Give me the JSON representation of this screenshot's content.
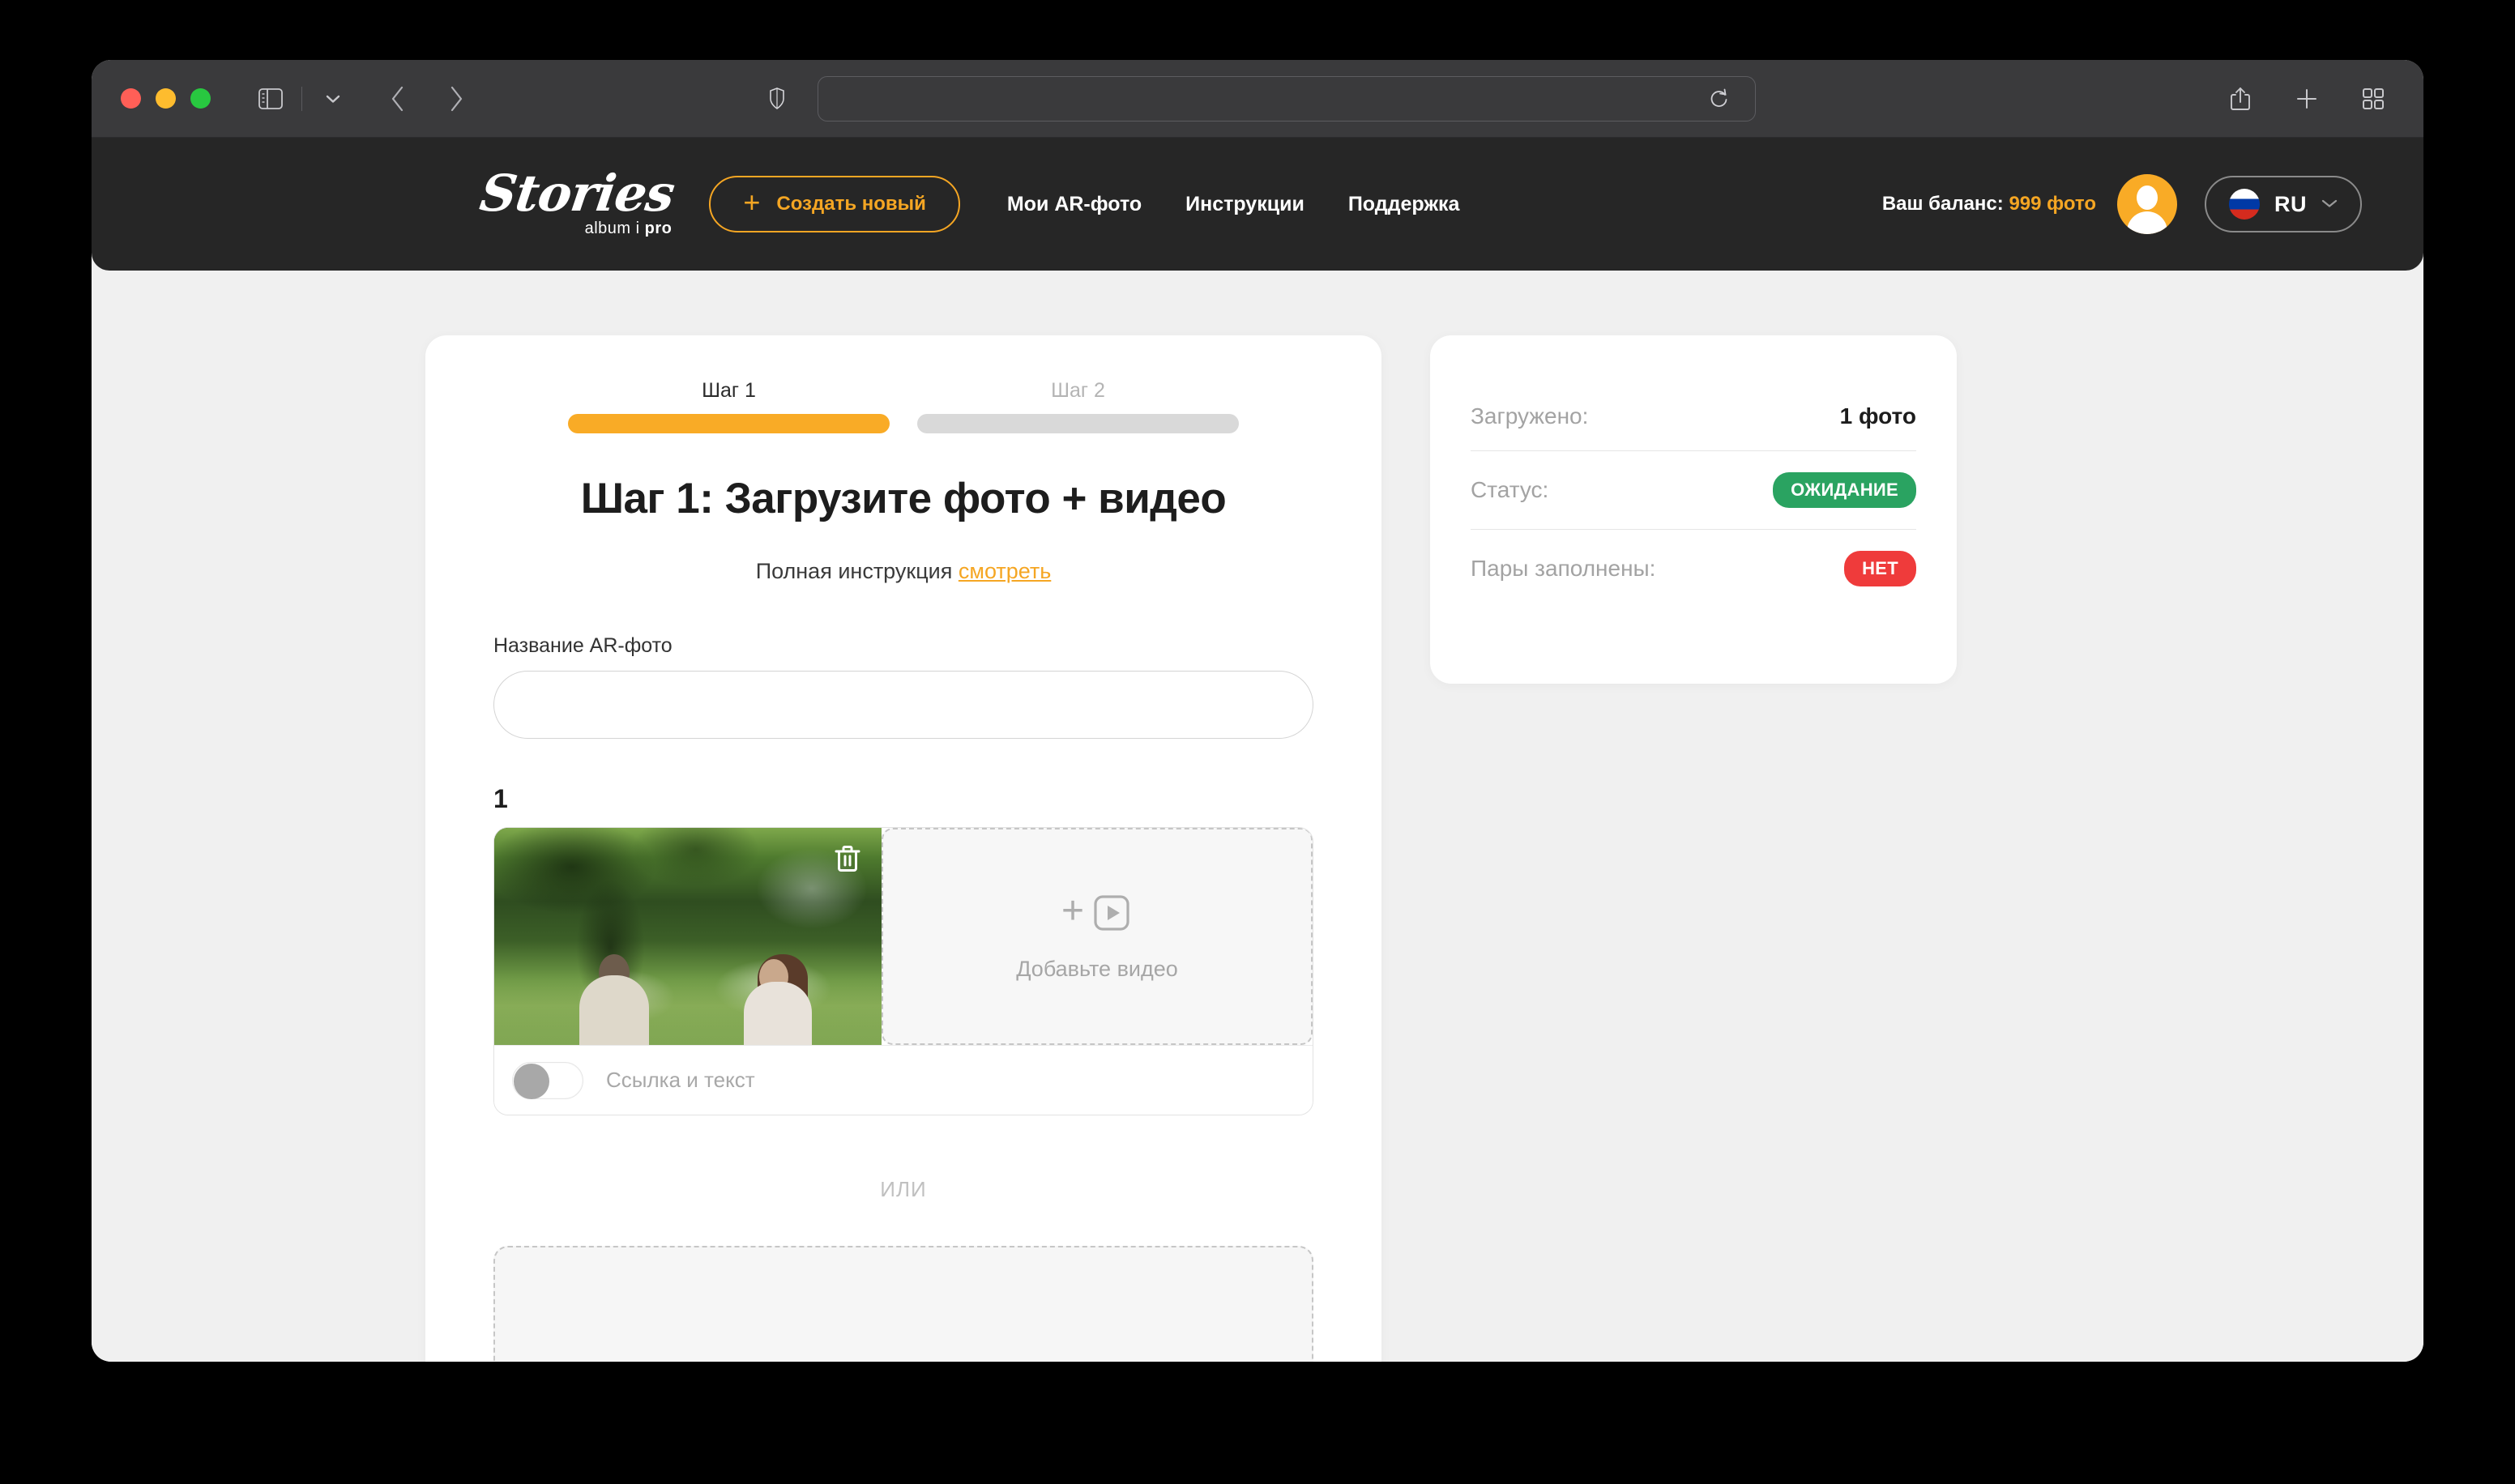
{
  "browser": {
    "traffic_lights": [
      "close",
      "minimize",
      "maximize"
    ],
    "sidebar_icon": "sidebar-icon",
    "dropdown_icon": "chevron-down-icon",
    "back_icon": "chevron-left-icon",
    "forward_icon": "chevron-right-icon",
    "shield_icon": "shield-icon",
    "address_value": "",
    "address_placeholder": "",
    "reload_icon": "reload-icon",
    "share_icon": "share-icon",
    "new_tab_icon": "plus-icon",
    "tab_overview_icon": "tab-grid-icon"
  },
  "header": {
    "brand_script": "Stories",
    "brand_sub_1": "album i ",
    "brand_sub_2": "pro",
    "create_button": "Создать новый",
    "create_button_icon": "plus-icon",
    "nav": [
      {
        "label": "Мои AR-фото"
      },
      {
        "label": "Инструкции"
      },
      {
        "label": "Поддержка"
      }
    ],
    "balance_label": "Ваш баланс:",
    "balance_value": "999 фото",
    "avatar_icon": "user-avatar-icon",
    "lang_code": "RU",
    "lang_flag": "flag-ru-icon",
    "lang_chevron_icon": "chevron-down-icon",
    "accent_color": "#f5a623",
    "header_bg": "#262626"
  },
  "main_card": {
    "steps": [
      {
        "label": "Шаг 1",
        "active": true
      },
      {
        "label": "Шаг 2",
        "active": false
      }
    ],
    "title": "Шаг 1: Загрузите фото + видео",
    "subtitle_text": "Полная инструкция ",
    "subtitle_link": "смотреть",
    "name_field_label": "Название AR-фото",
    "name_field_value": "",
    "name_field_placeholder": "",
    "pair_index": "1",
    "photo_slot": {
      "delete_icon": "trash-icon",
      "alt": "photo-thumbnail"
    },
    "video_slot": {
      "icon": "add-video-icon",
      "label": "Добавьте видео"
    },
    "toggle": {
      "label": "Ссылка и текст",
      "state": "off"
    },
    "or_divider": "ИЛИ"
  },
  "status_card": {
    "rows": [
      {
        "key": "Загружено:",
        "value": "1 фото",
        "type": "text"
      },
      {
        "key": "Статус:",
        "value": "ОЖИДАНИЕ",
        "type": "badge",
        "color": "#2aa361"
      },
      {
        "key": "Пары заполнены:",
        "value": "НЕТ",
        "type": "badge",
        "color": "#ef3b3b"
      }
    ]
  }
}
